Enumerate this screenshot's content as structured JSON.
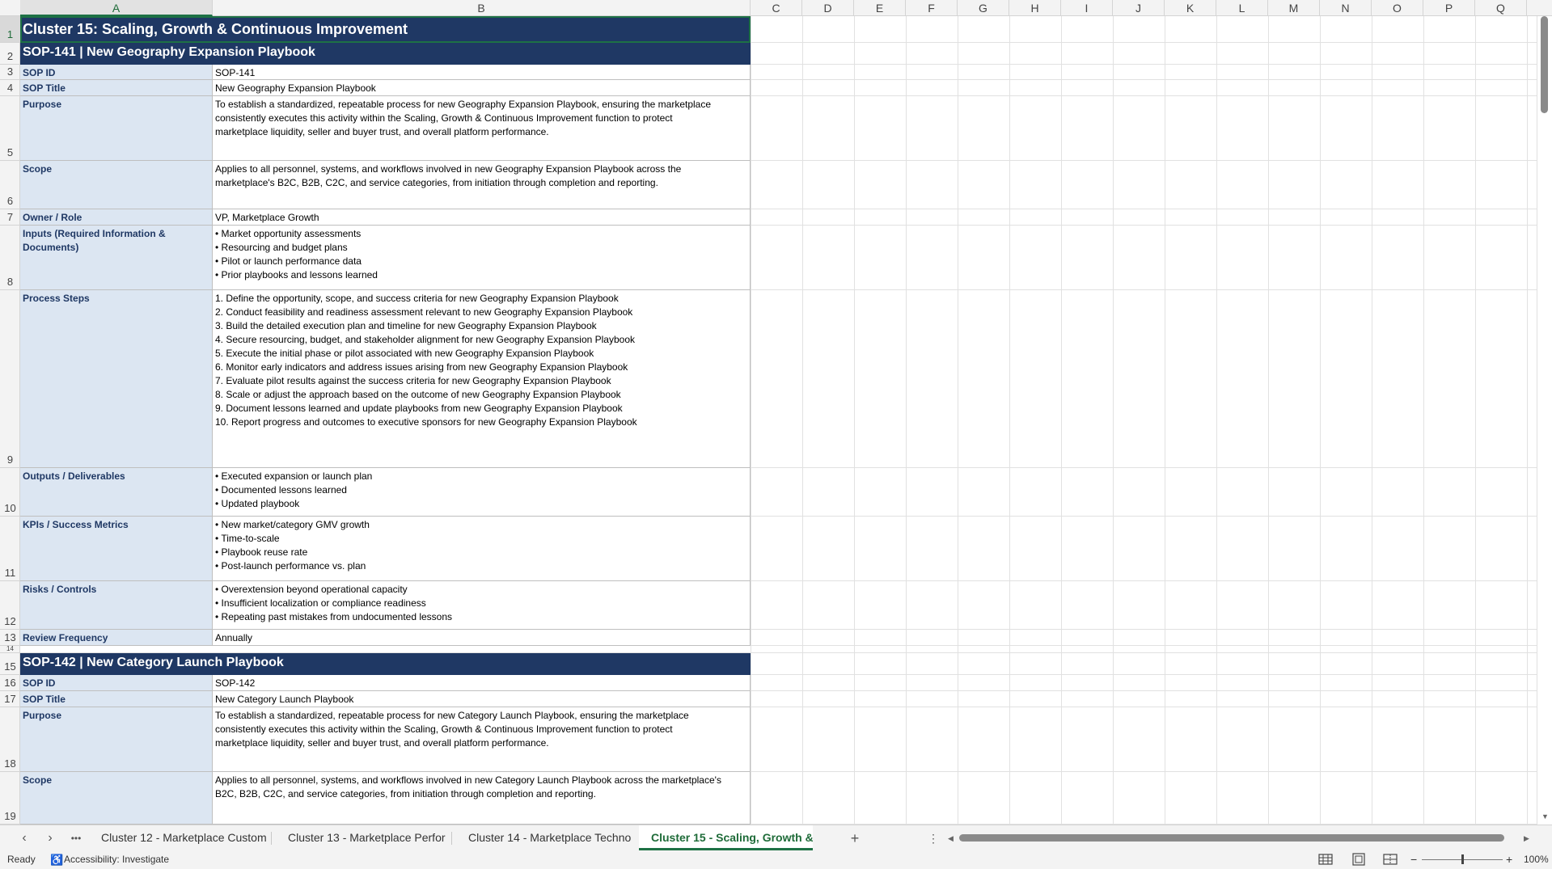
{
  "columns": [
    "A",
    "B",
    "C",
    "D",
    "E",
    "F",
    "G",
    "H",
    "I",
    "J",
    "K",
    "L",
    "M",
    "N",
    "O",
    "P",
    "Q"
  ],
  "rows": [
    "1",
    "2",
    "3",
    "4",
    "5",
    "6",
    "7",
    "8",
    "9",
    "10",
    "11",
    "12",
    "13",
    "14",
    "15",
    "16",
    "17",
    "18",
    "19"
  ],
  "sheet": {
    "title": "Cluster 15: Scaling, Growth & Continuous Improvement",
    "sop141": {
      "banner": "SOP-141  |  New Geography Expansion Playbook",
      "fields": [
        {
          "label": "SOP ID",
          "value": "SOP-141"
        },
        {
          "label": "SOP Title",
          "value": "New Geography Expansion Playbook"
        },
        {
          "label": "Purpose",
          "value": "To establish a standardized, repeatable process for new Geography Expansion Playbook, ensuring the marketplace\nconsistently executes this activity within the Scaling, Growth & Continuous Improvement function to protect\nmarketplace liquidity, seller and buyer trust, and overall platform performance."
        },
        {
          "label": "Scope",
          "value": "Applies to all personnel, systems, and workflows involved in new Geography Expansion Playbook across the\nmarketplace's B2C, B2B, C2C, and service categories, from initiation through completion and reporting."
        },
        {
          "label": "Owner / Role",
          "value": "VP, Marketplace Growth"
        },
        {
          "label": "Inputs (Required Information &\nDocuments)",
          "value": "• Market opportunity assessments\n• Resourcing and budget plans\n• Pilot or launch performance data\n• Prior playbooks and lessons learned"
        },
        {
          "label": "Process Steps",
          "value": "1. Define the opportunity, scope, and success criteria for new Geography Expansion Playbook\n2. Conduct feasibility and readiness assessment relevant to new Geography Expansion Playbook\n3. Build the detailed execution plan and timeline for new Geography Expansion Playbook\n4. Secure resourcing, budget, and stakeholder alignment for new Geography Expansion Playbook\n5. Execute the initial phase or pilot associated with new Geography Expansion Playbook\n6. Monitor early indicators and address issues arising from new Geography Expansion Playbook\n7. Evaluate pilot results against the success criteria for new Geography Expansion Playbook\n8. Scale or adjust the approach based on the outcome of new Geography Expansion Playbook\n9. Document lessons learned and update playbooks from new Geography Expansion Playbook\n10. Report progress and outcomes to executive sponsors for new Geography Expansion Playbook"
        },
        {
          "label": "Outputs / Deliverables",
          "value": "• Executed expansion or launch plan\n• Documented lessons learned\n• Updated playbook"
        },
        {
          "label": "KPIs / Success Metrics",
          "value": "• New market/category GMV growth\n• Time-to-scale\n• Playbook reuse rate\n• Post-launch performance vs. plan"
        },
        {
          "label": "Risks / Controls",
          "value": "• Overextension beyond operational capacity\n• Insufficient localization or compliance readiness\n• Repeating past mistakes from undocumented lessons"
        },
        {
          "label": "Review Frequency",
          "value": "Annually"
        }
      ]
    },
    "sop142": {
      "banner": "SOP-142  |  New Category Launch Playbook",
      "fields": [
        {
          "label": "SOP ID",
          "value": "SOP-142"
        },
        {
          "label": "SOP Title",
          "value": "New Category Launch Playbook"
        },
        {
          "label": "Purpose",
          "value": "To establish a standardized, repeatable process for new Category Launch Playbook, ensuring the marketplace\nconsistently executes this activity within the Scaling, Growth & Continuous Improvement function to protect\nmarketplace liquidity, seller and buyer trust, and overall platform performance."
        },
        {
          "label": "Scope",
          "value": "Applies to all personnel, systems, and workflows involved in new Category Launch Playbook across the marketplace's\nB2C, B2B, C2C, and service categories, from initiation through completion and reporting."
        }
      ]
    }
  },
  "tabs": [
    {
      "label": "Cluster 12 - Marketplace Custom",
      "active": false
    },
    {
      "label": "Cluster 13 - Marketplace Perfor",
      "active": false
    },
    {
      "label": "Cluster 14 - Marketplace Techno",
      "active": false
    },
    {
      "label": "Cluster 15 - Scaling, Growth &",
      "active": true
    }
  ],
  "tabbar": {
    "more": "•••",
    "add": "+",
    "options": "⋮",
    "prev": "‹",
    "next": "›"
  },
  "status": {
    "ready": "Ready",
    "accessibility": "Accessibility: Investigate",
    "zoom": "100%",
    "zoom_minus": "−",
    "zoom_plus": "+"
  },
  "colors": {
    "banner": "#1f3864",
    "label_fill": "#dce6f2",
    "accent": "#1e7145"
  }
}
